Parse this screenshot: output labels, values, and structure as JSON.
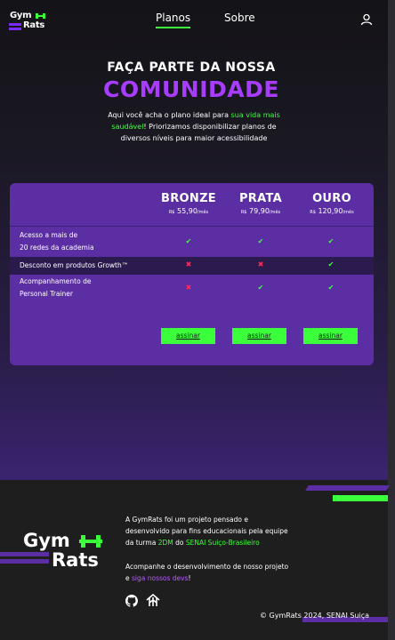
{
  "nav": {
    "logo_top": "Gym",
    "logo_bottom": "Rats",
    "links": [
      {
        "label": "Planos",
        "active": true
      },
      {
        "label": "Sobre",
        "active": false
      }
    ],
    "user_icon": "user-icon"
  },
  "hero": {
    "title_small": "FAÇA PARTE DA NOSSA",
    "title_big": "COMUNIDADE",
    "intro_a": "Aqui você acha o plano ideal para ",
    "intro_highlight": "sua vida mais saudável",
    "intro_b": "! Priorizamos disponibilizar planos de diversos níveis para maior acessibilidade"
  },
  "plans": [
    {
      "name": "BRONZE",
      "currency": "R$",
      "price": "55,90",
      "period": "/mês",
      "button": "assinar"
    },
    {
      "name": "PRATA",
      "currency": "R$",
      "price": "79,90",
      "period": "/mês",
      "button": "assinar"
    },
    {
      "name": "OURO",
      "currency": "R$",
      "price": "120,90",
      "period": "/mês",
      "button": "assinar"
    }
  ],
  "features": [
    {
      "line1": "Acesso a mais de",
      "line2": "20 redes da academia",
      "included": [
        true,
        true,
        true
      ]
    },
    {
      "line1": "Desconto em produtos Growth™",
      "line2": "",
      "included": [
        false,
        false,
        true
      ]
    },
    {
      "line1": "Acompanhamento de",
      "line2": "Personal Trainer",
      "included": [
        false,
        true,
        true
      ]
    }
  ],
  "colors": {
    "accent_green": "#3bff3b",
    "accent_purple": "#a93dff",
    "card": "#5b2fa3",
    "cross": "#ff2a5a"
  },
  "footer": {
    "logo_top": "Gym",
    "logo_bottom": "Rats",
    "about_a": "A GymRats foi um projeto pensado e desenvolvido para fins educacionais pela equipe da turma ",
    "about_team": "2DM",
    "about_b": " do ",
    "about_school": "SENAI Suiço-Brasileiro",
    "follow_a": "Acompanhe o desenvolvimento de nosso projeto e ",
    "follow_link": "siga nossos devs",
    "follow_b": "!",
    "icons": [
      "github-icon",
      "sourcebox-icon"
    ],
    "copyright": "© GymRats 2024, SENAI Suiça"
  }
}
